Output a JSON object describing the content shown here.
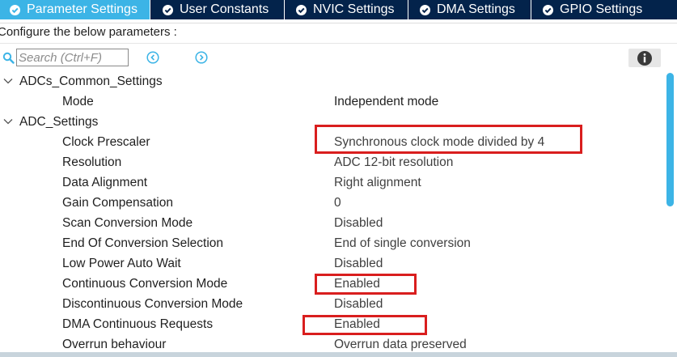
{
  "tabs": [
    {
      "label": "Parameter Settings",
      "active": true,
      "icon": "check-circle-icon"
    },
    {
      "label": "User Constants",
      "active": false,
      "icon": "check-circle-icon"
    },
    {
      "label": "NVIC Settings",
      "active": false,
      "icon": "check-circle-icon"
    },
    {
      "label": "DMA Settings",
      "active": false,
      "icon": "check-circle-icon"
    },
    {
      "label": "GPIO Settings",
      "active": false,
      "icon": "check-circle-icon"
    }
  ],
  "configure_label": "Configure the below parameters :",
  "search": {
    "placeholder": "Search (Ctrl+F)",
    "value": ""
  },
  "colors": {
    "tab_bar": "#03234b",
    "tab_active": "#3cb4e6",
    "highlight_box": "#d91e1e",
    "scroll_thumb": "#3cb4e6"
  },
  "tree": {
    "group_common": {
      "label": "ADCs_Common_Settings",
      "items": [
        {
          "name": "Mode",
          "value": "Independent mode"
        }
      ]
    },
    "group_adc": {
      "label": "ADC_Settings",
      "items": [
        {
          "name": "Clock Prescaler",
          "value": "Synchronous clock mode divided by 4",
          "highlighted": true
        },
        {
          "name": "Resolution",
          "value": "ADC 12-bit resolution"
        },
        {
          "name": "Data Alignment",
          "value": "Right alignment"
        },
        {
          "name": "Gain Compensation",
          "value": "0"
        },
        {
          "name": "Scan Conversion Mode",
          "value": "Disabled"
        },
        {
          "name": "End Of Conversion Selection",
          "value": "End of single conversion"
        },
        {
          "name": "Low Power Auto Wait",
          "value": "Disabled"
        },
        {
          "name": "Continuous Conversion Mode",
          "value": "Enabled",
          "highlighted": true
        },
        {
          "name": "Discontinuous Conversion Mode",
          "value": "Disabled"
        },
        {
          "name": "DMA Continuous Requests",
          "value": "Enabled",
          "highlighted": true
        },
        {
          "name": "Overrun behaviour",
          "value": "Overrun data preserved"
        }
      ]
    }
  }
}
